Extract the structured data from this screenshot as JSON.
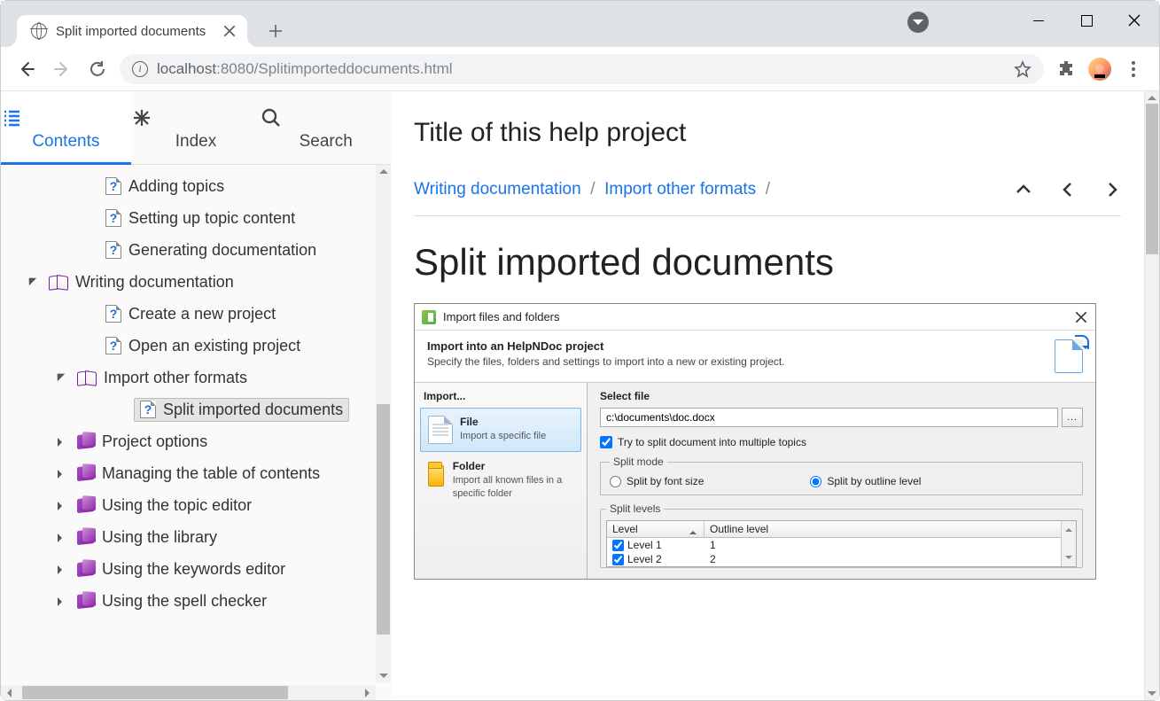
{
  "browser": {
    "tab_title": "Split imported documents",
    "url_host": "localhost",
    "url_port": ":8080",
    "url_path": "/Splitimporteddocuments.html"
  },
  "toc_tabs": {
    "contents": "Contents",
    "index": "Index",
    "search": "Search"
  },
  "tree": {
    "n0": "Adding topics",
    "n1": "Setting up topic content",
    "n2": "Generating documentation",
    "n3": "Writing documentation",
    "n4": "Create a new project",
    "n5": "Open an existing project",
    "n6": "Import other formats",
    "n7": "Split imported documents",
    "n8": "Project options",
    "n9": "Managing the table of contents",
    "n10": "Using the topic editor",
    "n11": "Using the library",
    "n12": "Using the keywords editor",
    "n13": "Using the spell checker"
  },
  "page": {
    "project_title": "Title of this help project",
    "crumb1": "Writing documentation",
    "crumb2": "Import other formats",
    "topic_title": "Split imported documents"
  },
  "dlg": {
    "title": "Import files and folders",
    "header_title": "Import into an HelpNDoc project",
    "header_sub": "Specify the files, folders and settings to import into a new or existing project.",
    "left_heading": "Import...",
    "opt_file_t": "File",
    "opt_file_s": "Import a specific file",
    "opt_folder_t": "Folder",
    "opt_folder_s": "Import all known files in a specific folder",
    "right_heading": "Select file",
    "path_value": "c:\\documents\\doc.docx",
    "browse": "...",
    "try_split": "Try to split document into multiple topics",
    "split_mode": "Split mode",
    "radio_font": "Split by font size",
    "radio_outline": "Split by outline level",
    "split_levels": "Split levels",
    "col_level": "Level",
    "col_outline": "Outline level",
    "row1_l": "Level 1",
    "row1_o": "1",
    "row2_l": "Level 2",
    "row2_o": "2"
  }
}
